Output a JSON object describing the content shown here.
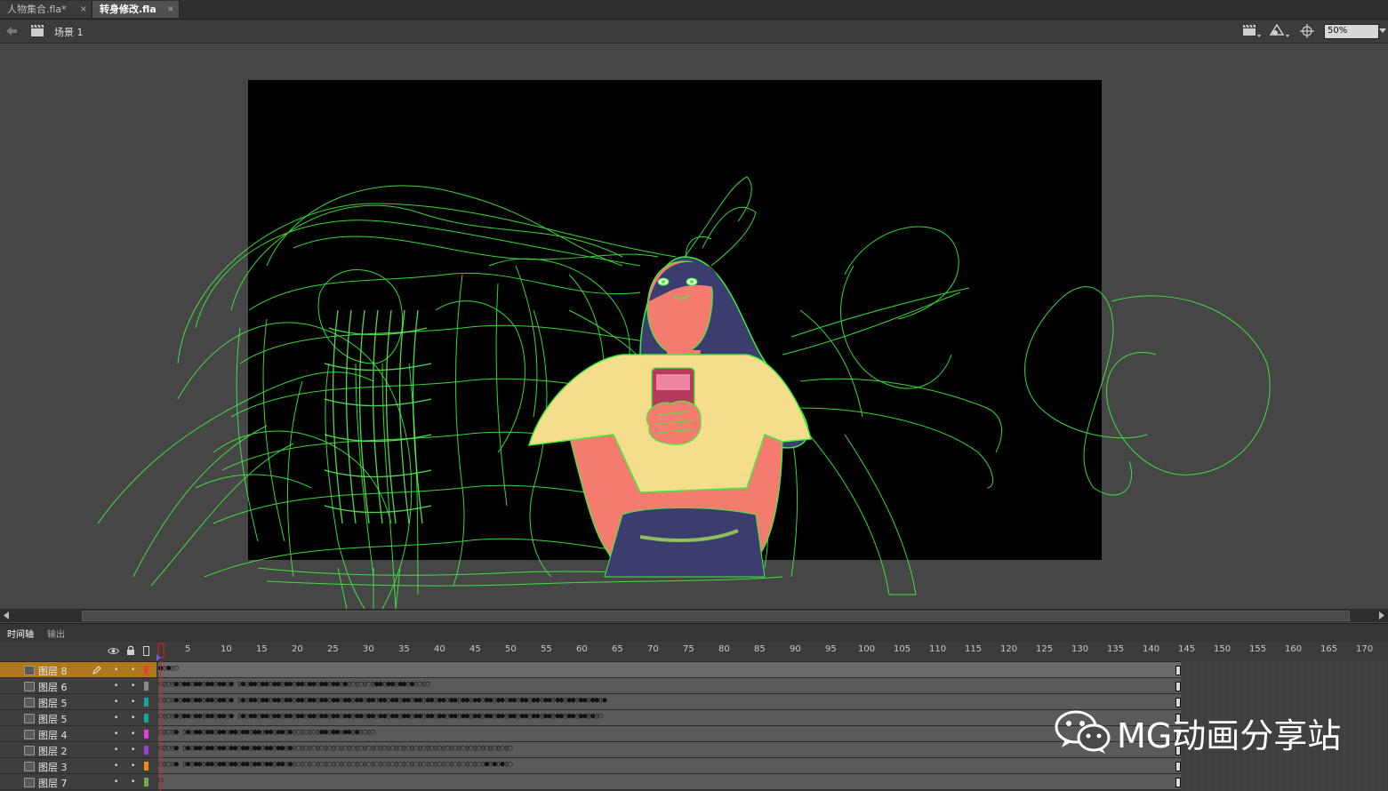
{
  "tabs": [
    {
      "label": "人物集合.fla*",
      "close": "×"
    },
    {
      "label": "转身修改.fla",
      "close": "×"
    }
  ],
  "editbar": {
    "back_icon": "back-arrow-icon",
    "scene_icon": "clapper-icon",
    "scene_label": "场景 1",
    "edit_scene_icon": "clapper-dropdown-icon",
    "edit_symbol_icon": "symbol-dropdown-icon",
    "center_icon": "crosshair-icon",
    "zoom_value": "50%"
  },
  "stage": {
    "canvas_color": "#000000",
    "pasteboard_color": "#464646",
    "stroke_color": "#3cf03c"
  },
  "panels": {
    "timeline_tab": "时间轴",
    "output_tab": "输出"
  },
  "timeline": {
    "ruler_ticks": [
      "5",
      "10",
      "15",
      "20",
      "25",
      "30",
      "35",
      "40",
      "45",
      "50",
      "55",
      "60",
      "65",
      "70",
      "75",
      "80",
      "85",
      "90",
      "95",
      "100",
      "105",
      "110",
      "115",
      "120",
      "125",
      "130",
      "135",
      "140",
      "145",
      "150",
      "155",
      "160",
      "165",
      "170"
    ],
    "header_icons": [
      "eye-icon",
      "lock-icon",
      "outline-icon"
    ],
    "layers": [
      {
        "name": "图层 8",
        "color": "#e8462a",
        "selected": true,
        "frames": "●▯●▯○"
      },
      {
        "name": "图层 6",
        "color": "#8a8a8a",
        "selected": false,
        "frames": "○▯○▯●▯●●▯●●▯●●▯●●▯●     ▯●▯●●▯●●▯●●▯●●▯●●▯●●▯●●▯●●▯●▯○▯○▯○▯●●▯●●▯●●▯●▯○▯○"
      },
      {
        "name": "图层 5",
        "color": "#1aa3a3",
        "selected": false,
        "frames": "○▯○▯●▯●●▯●●▯●●▯●●▯●     ▯●▯●●▯●●▯●●▯●●▯●●▯●●▯●●▯●●▯●●▯●●▯●●▯●●▯●●▯●●▯●●▯●●▯●●▯●●▯●●▯●●▯●●▯●●▯●●▯●●▯●●▯●●▯●●▯●●▯●●▯●●▯●"
      },
      {
        "name": "图层 5",
        "color": "#1aa3a3",
        "selected": false,
        "frames": "○▯○▯●▯●●▯●●▯●●▯●●▯●     ▯●▯●●▯●●▯●●▯●●▯●●▯●●▯●●▯●●▯●●▯●●▯●●▯●●▯●●▯●●▯●●▯●●▯●●▯●●▯●●▯●●▯●●▯●●▯●●▯●●▯●●▯●●▯●●▯●●▯●●▯●▯○"
      },
      {
        "name": "图层 4",
        "color": "#e040e0",
        "selected": false,
        "frames": "○▯○▯●                ▯●▯●●▯●●▯●●▯●●▯●●▯●●▯●●▯●●▯●▯○▯○▯○▯●●▯●●▯●●▯●▯○▯○"
      },
      {
        "name": "图层 2",
        "color": "#9a40d0",
        "selected": false,
        "frames": "○▯○▯●                ▯●▯●●▯●●▯●●▯●●▯●●▯●●▯●●▯●●▯●▯○▯○▯○▯○▯○▯○▯○▯○▯○▯○▯○▯○▯○▯○▯○▯○▯○▯○▯○▯○▯○▯○▯○▯○▯○▯○▯○▯○"
      },
      {
        "name": "图层 3",
        "color": "#f08a1a",
        "selected": false,
        "frames": "○▯○▯●                ▯●▯●●▯●●▯●●▯●●▯●●▯●●▯●●▯●●▯●▯○▯○▯○▯○▯○▯○▯○▯○▯○▯○▯○▯○▯○▯○▯○▯○▯○▯○▯○▯○▯○▯○▯○▯○▯●▯●▯●▯○"
      },
      {
        "name": "图层 7",
        "color": "#6ab04a",
        "selected": false,
        "frames": "○"
      }
    ]
  },
  "watermark": {
    "text": "MG动画分享站",
    "icon": "wechat-icon"
  }
}
